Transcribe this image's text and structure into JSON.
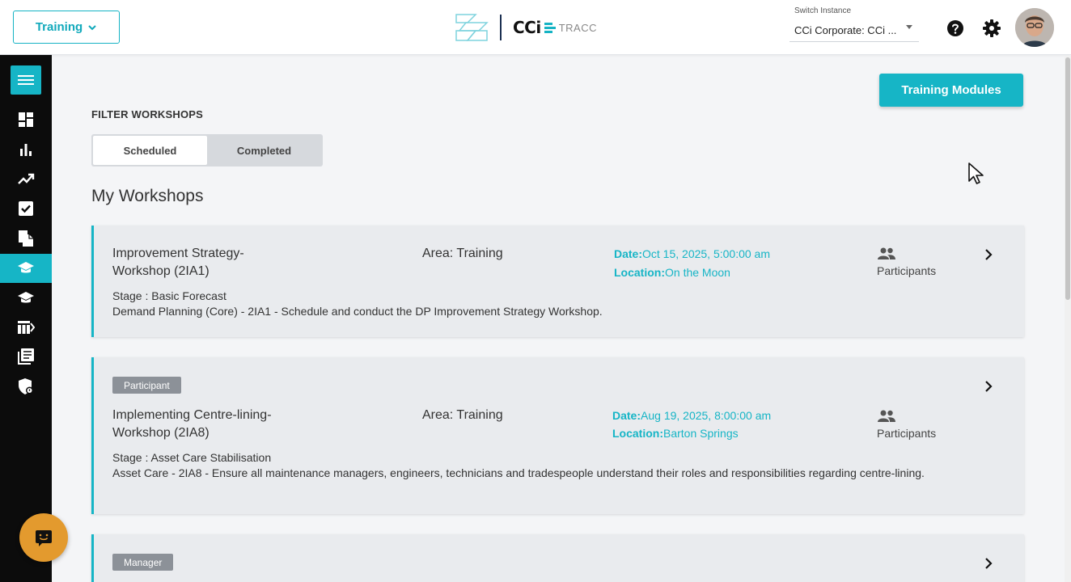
{
  "header": {
    "module_label": "Training",
    "logo_text": "CCi",
    "logo_sub": "TRACC",
    "instance_label": "Switch Instance",
    "instance_value": "CCi Corporate: CCi ..."
  },
  "sidebar": {
    "items": [
      "dashboard",
      "reports",
      "trends",
      "tasks",
      "documents",
      "training",
      "learning",
      "board",
      "library",
      "security"
    ],
    "active": "training"
  },
  "main": {
    "primary_button": "Training Modules",
    "filter_title": "FILTER WORKSHOPS",
    "filter_options": [
      "Scheduled",
      "Completed"
    ],
    "active_filter": "Scheduled",
    "section_title": "My Workshops",
    "workshops": [
      {
        "badge": "",
        "title": "Improvement Strategy-Workshop (2IA1)",
        "area": "Area: Training",
        "date_label": "Date:",
        "date": "Oct 15, 2025, 5:00:00 am",
        "location_label": "Location:",
        "location": "On the Moon",
        "participants": "Participants",
        "stage": "Stage : Basic Forecast",
        "description": "Demand Planning (Core) - 2IA1 - Schedule and conduct the DP Improvement Strategy Workshop."
      },
      {
        "badge": "Participant",
        "title": "Implementing Centre-lining-Workshop (2IA8)",
        "area": "Area: Training",
        "date_label": "Date:",
        "date": "Aug 19, 2025, 8:00:00 am",
        "location_label": "Location:",
        "location": "Barton Springs",
        "participants": "Participants",
        "stage": "Stage : Asset Care Stabilisation",
        "description": "Asset Care - 2IA8 - Ensure all maintenance managers, engineers, technicians and tradespeople understand their roles and responsibilities regarding centre-lining."
      },
      {
        "badge": "Manager"
      }
    ]
  },
  "colors": {
    "accent": "#16b5c6",
    "sidebar_bg": "#0c0c0c",
    "chat": "#e39a2e"
  }
}
